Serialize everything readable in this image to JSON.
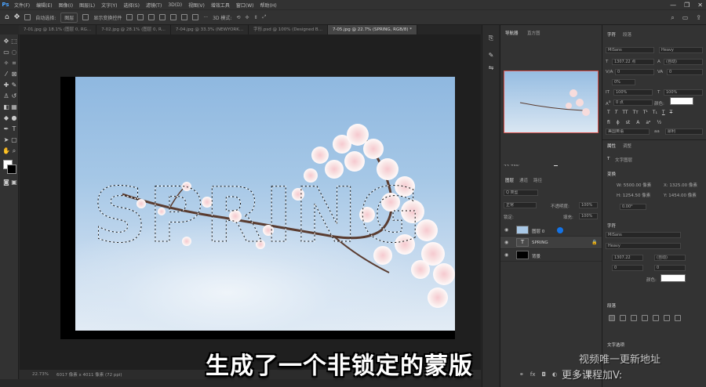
{
  "app": {
    "logo": "Ps"
  },
  "menu": [
    "文件(F)",
    "编辑(E)",
    "图像(I)",
    "图层(L)",
    "文字(Y)",
    "选择(S)",
    "滤镜(T)",
    "3D(D)",
    "视图(V)",
    "增效工具",
    "窗口(W)",
    "帮助(H)"
  ],
  "window_controls": [
    "—",
    "❐",
    "✕"
  ],
  "options_bar": {
    "auto_select": "自动选择:",
    "target": "图层",
    "show_transform": "显示变换控件",
    "mode_3d": "3D 模式:"
  },
  "tabs": [
    {
      "label": "7-01.jpg @ 18.1% (图层 0, RG...",
      "active": false
    },
    {
      "label": "7-02.jpg @ 28.1% (图层 0, R...",
      "active": false
    },
    {
      "label": "7-04.jpg @ 33.3% (NEWYORK...",
      "active": false
    },
    {
      "label": "字形.psd @ 100% (Designed B...",
      "active": false
    },
    {
      "label": "7-05.jpg @ 22.7% (SPRING, RGB/8) *",
      "active": true
    }
  ],
  "canvas": {
    "text": "SPRING"
  },
  "status_bar": {
    "zoom": "22.73%",
    "doc_size": "6017 像素 x 4011 像素 (72 ppi)"
  },
  "navigator": {
    "tabs": [
      "导航器",
      "直方图"
    ],
    "zoom": "22.73%"
  },
  "layers_panel": {
    "tabs": [
      "图层",
      "通道",
      "路径"
    ],
    "filter": "Q 类型",
    "blend_mode": "正常",
    "opacity_label": "不透明度:",
    "opacity_value": "100%",
    "lock_label": "锁定:",
    "fill_label": "填充:",
    "fill_value": "100%",
    "layers": [
      {
        "name": "图层 0",
        "type": "image",
        "thumb_color": "#a9c8e6"
      },
      {
        "name": "SPRING",
        "type": "text",
        "thumb_color": "#4a4a4a"
      },
      {
        "name": "背景",
        "type": "fill",
        "thumb_color": "#000000"
      }
    ]
  },
  "character_panel": {
    "tabs": [
      "字符",
      "段落"
    ],
    "font": "MiSans",
    "style": "Heavy",
    "size": "1307.22 点",
    "leading": "(自动)",
    "kerning": "0",
    "tracking": "0",
    "scale_label": "0%",
    "vscale": "100%",
    "hscale": "100%",
    "baseline": "0 点",
    "color_label": "颜色:",
    "language": "美国英语",
    "aa": "犀利",
    "swatch": "#ffffff"
  },
  "properties_panel": {
    "tabs": [
      "属性",
      "调整"
    ],
    "type_label": "文字图层",
    "transform_label": "变换",
    "w": "W: 5500.00 像素",
    "x": "X: 1325.00 像素",
    "h": "H: 1254.50 像素",
    "y": "Y: 1454.00 像素",
    "angle": "0.00°",
    "char_section": "字符",
    "font": "MiSans",
    "style": "Heavy",
    "size": "1307.22",
    "leading": "(自动)",
    "kerning": "0",
    "tracking": "0",
    "color_label": "颜色:",
    "para_section": "段落",
    "text_options": "文字选项"
  },
  "subtitle": "生成了一个非锁定的蒙版",
  "watermark": {
    "line1": "视频唯一更新地址",
    "line2": "更多课程加V:"
  },
  "colors": {
    "ui_dark": "#282828",
    "panel": "#333333",
    "accent": "#1473e6",
    "highlight": "#d9534f"
  }
}
